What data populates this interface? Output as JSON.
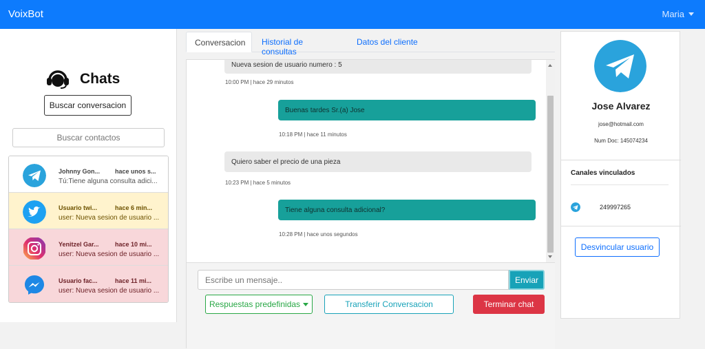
{
  "navbar": {
    "brand": "VoixBot",
    "user": "Maria"
  },
  "sidebar": {
    "title": "Chats",
    "search_conversation_label": "Buscar conversacion",
    "contact_search_placeholder": "Buscar contactos",
    "chats": [
      {
        "channel": "telegram",
        "name": "Johnny Gon...",
        "time": "hace unos s...",
        "preview": "Tú:Tiene alguna consulta adici...",
        "status": "plain"
      },
      {
        "channel": "twitter",
        "name": "Usuario twi...",
        "time": "hace 6 min...",
        "preview": "user: Nueva sesion de usuario ...",
        "status": "yellow"
      },
      {
        "channel": "instagram",
        "name": "Yenitzel Gar...",
        "time": "hace 10 mi...",
        "preview": "user: Nueva sesion de usuario ...",
        "status": "red"
      },
      {
        "channel": "messenger",
        "name": "Usuario fac...",
        "time": "hace 11 mi...",
        "preview": "user: Nueva sesion de usuario ...",
        "status": "red"
      }
    ]
  },
  "tabs": [
    {
      "label": "Conversacion",
      "active": true
    },
    {
      "label": "Historial de consultas",
      "active": false
    },
    {
      "label": "Datos del cliente",
      "active": false
    }
  ],
  "messages": [
    {
      "direction": "in",
      "text": "Nueva sesion de usuario numero : 5",
      "meta": "10:00 PM | hace 29 minutos"
    },
    {
      "direction": "out",
      "text": "Buenas tardes Sr.(a) Jose",
      "meta": "10:18 PM | hace 11 minutos"
    },
    {
      "direction": "in",
      "text": "Quiero saber el precio de una pieza",
      "meta": "10:23 PM | hace 5 minutos"
    },
    {
      "direction": "out",
      "text": "Tiene alguna consulta adicional?",
      "meta": "10:28 PM | hace unos segundos"
    }
  ],
  "composer": {
    "placeholder": "Escribe un mensaje..",
    "send_label": "Enviar",
    "predefined_label": "Respuestas predefinidas",
    "transfer_label": "Transferir Conversacion",
    "end_label": "Terminar chat"
  },
  "client": {
    "name": "Jose Alvarez",
    "email": "jose@hotmail.com",
    "doc": "Num Doc: 145074234",
    "channels_title": "Canales vinculados",
    "channel_id": "249997265",
    "unlink_label": "Desvincular usuario"
  },
  "colors": {
    "navbar": "#0d7bfd",
    "telegram": "#2aa3dc",
    "twitter": "#1da1f2",
    "messenger": "#1e88e5",
    "outgoing_bubble": "#17a09a",
    "danger": "#dc3545",
    "success": "#28a745"
  }
}
